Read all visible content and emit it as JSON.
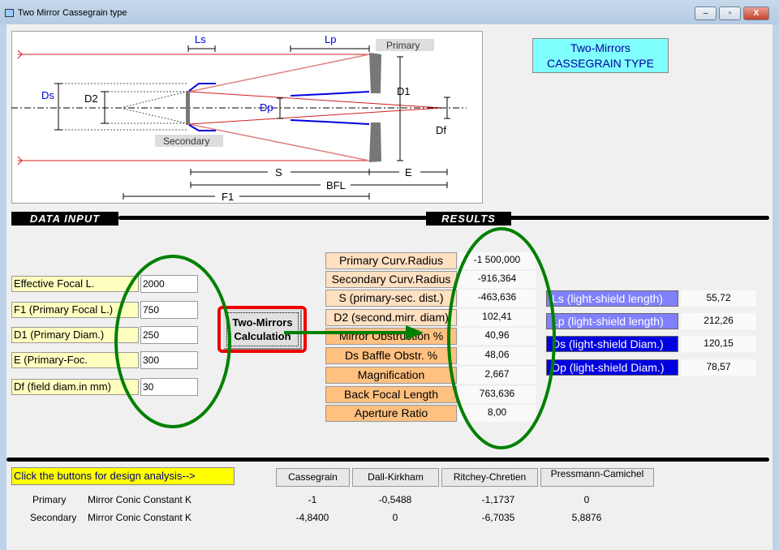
{
  "window": {
    "title": "Two Mirror Cassegrain type",
    "minimize": "–",
    "maximize": "▫",
    "close": "X"
  },
  "diagram": {
    "labels": {
      "ls": "Ls",
      "lp": "Lp",
      "primary": "Primary",
      "secondary": "Secondary",
      "ds": "Ds",
      "d2": "D2",
      "dp": "Dp",
      "d1": "D1",
      "df": "Df",
      "s": "S",
      "e": "E",
      "bfl": "BFL",
      "f1": "F1"
    }
  },
  "title_box": {
    "line1": "Two-Mirrors",
    "line2": "CASSEGRAIN  TYPE"
  },
  "sections": {
    "data_input": "DATA  INPUT",
    "results": "RESULTS"
  },
  "inputs": [
    {
      "label": "Effective Focal L.",
      "value": "2000"
    },
    {
      "label": "F1 (Primary Focal L.)",
      "value": "750"
    },
    {
      "label": "D1 (Primary Diam.)",
      "value": "250"
    },
    {
      "label": "E (Primary-Foc.",
      "value": "300"
    },
    {
      "label": "Df (field  diam.in mm)",
      "value": "30"
    }
  ],
  "calc_button": {
    "line1": "Two-Mirrors",
    "line2": "Calculation"
  },
  "results": [
    {
      "label": "Primary Curv.Radius",
      "value": "-1 500,000"
    },
    {
      "label": "Secondary Curv.Radius",
      "value": "-916,364"
    },
    {
      "label": "S (primary-sec.  dist.)",
      "value": "-463,636"
    },
    {
      "label": "D2 (second.mirr. diam)",
      "value": "102,41"
    },
    {
      "label": "Mirror Obstruction %",
      "value": "40,96"
    },
    {
      "label": "Ds   Baffle Obstr. %",
      "value": "48,06"
    },
    {
      "label": "Magnification",
      "value": "2,667"
    },
    {
      "label": "Back Focal Length",
      "value": "763,636"
    },
    {
      "label": "Aperture Ratio",
      "value": "8,00"
    }
  ],
  "shields": [
    {
      "label": "Ls (light-shield length)",
      "value": "55,72",
      "color": "#8080ff"
    },
    {
      "label": "Lp (light-shield length)",
      "value": "212,26",
      "color": "#8080ff"
    },
    {
      "label": "Ds (light-shield Diam.)",
      "value": "120,15",
      "color": "#0000e0"
    },
    {
      "label": "Dp (light-shield Diam.)",
      "value": "78,57",
      "color": "#0000e0"
    }
  ],
  "analysis": {
    "hint": "Click the buttons for design analysis-->",
    "buttons": [
      "Cassegrain",
      "Dall-Kirkham",
      "Ritchey-Chretien",
      "Pressmann-Camichel"
    ],
    "rows": [
      {
        "label1": "Primary",
        "label2": "Mirror Conic Constant  K",
        "values": [
          "-1",
          "-0,5488",
          "-1,1737",
          "0"
        ]
      },
      {
        "label1": "Secondary",
        "label2": "Mirror Conic Constant  K",
        "values": [
          "-4,8400",
          "0",
          "-6,7035",
          "5,8876"
        ]
      }
    ]
  },
  "colors": {
    "annotation": "#008000",
    "highlight": "#ff0000",
    "input_bg": "#ffffc0",
    "result_bg": "#ffc080"
  }
}
